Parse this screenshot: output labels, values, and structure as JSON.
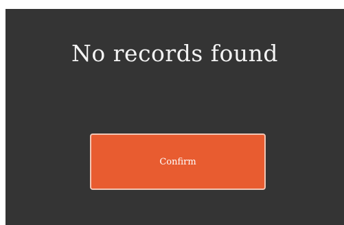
{
  "dialog": {
    "message": "No records found",
    "confirm_label": "Confirm"
  },
  "colors": {
    "dialog_background": "#343434",
    "button_background": "#e85c30",
    "button_border": "#f2c7b6",
    "text": "#f3f3f3"
  }
}
